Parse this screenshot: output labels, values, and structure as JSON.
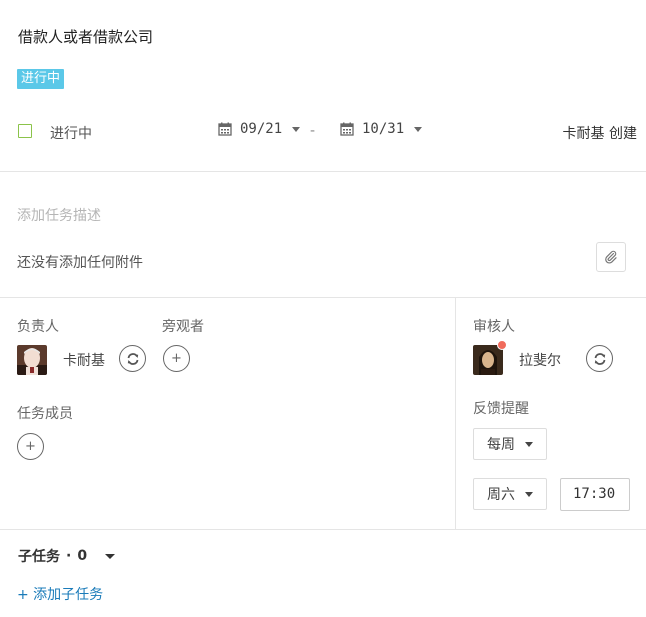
{
  "task": {
    "title": "借款人或者借款公司",
    "status_badge": "进行中",
    "status_text": "进行中",
    "start_date": "09/21",
    "date_separator": "-",
    "end_date": "10/31",
    "creator": "卡耐基 创建"
  },
  "description": {
    "placeholder": "添加任务描述",
    "no_attachment": "还没有添加任何附件"
  },
  "people": {
    "owner_label": "负责人",
    "owner_name": "卡耐基",
    "watcher_label": "旁观者",
    "members_label": "任务成员",
    "reviewer_label": "审核人",
    "reviewer_name": "拉斐尔"
  },
  "feedback": {
    "label": "反馈提醒",
    "frequency": "每周",
    "weekday": "周六",
    "time": "17:30"
  },
  "subtasks": {
    "title": "子任务",
    "separator": "·",
    "count": "0",
    "add_label": "+ 添加子任务"
  },
  "colors": {
    "badge": "#5bc8e8",
    "checkbox": "#8bc34a",
    "link": "#1a7bb9",
    "notification_dot": "#f06b5c"
  }
}
